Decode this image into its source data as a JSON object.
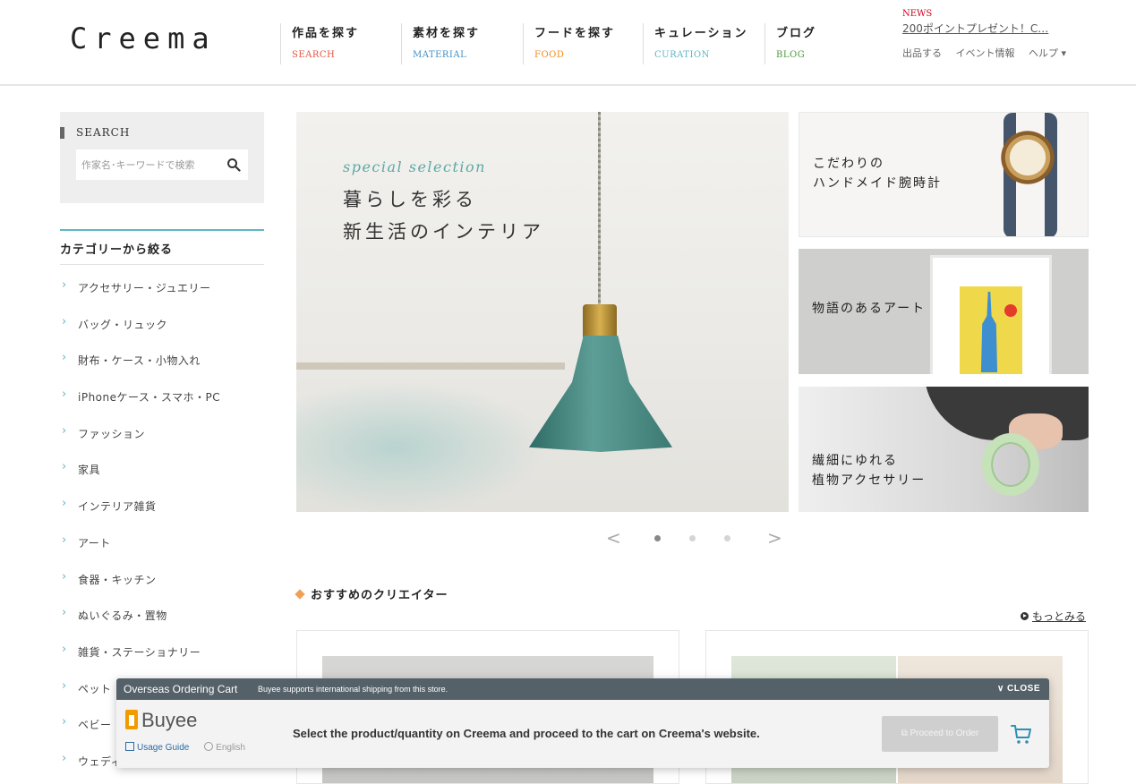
{
  "header": {
    "logo": "Creema",
    "nav": [
      {
        "jp": "作品を探す",
        "en": "SEARCH",
        "color": "#e5533d"
      },
      {
        "jp": "素材を探す",
        "en": "MATERIAL",
        "color": "#3f8fc5"
      },
      {
        "jp": "フードを探す",
        "en": "FOOD",
        "color": "#f08a1a"
      },
      {
        "jp": "キュレーション",
        "en": "CURATION",
        "color": "#5fb7c4"
      },
      {
        "jp": "ブログ",
        "en": "BLOG",
        "color": "#4a9a3a"
      }
    ],
    "news_label": "NEWS",
    "news_text": "200ポイントプレゼント！C…",
    "util_links": [
      "出品する",
      "イベント情報",
      "ヘルプ ▾"
    ]
  },
  "sidebar": {
    "search_title": "SEARCH",
    "search_placeholder": "作家名･キーワードで検索",
    "category_title": "カテゴリーから絞る",
    "categories": [
      "アクセサリー・ジュエリー",
      "バッグ・リュック",
      "財布・ケース・小物入れ",
      "iPhoneケース・スマホ・PC",
      "ファッション",
      "家具",
      "インテリア雑貨",
      "アート",
      "食器・キッチン",
      "ぬいぐるみ・置物",
      "雑貨・ステーショナリー",
      "ペット",
      "ベビー",
      "ウェディ"
    ]
  },
  "hero": {
    "subtitle": "special selection",
    "title_line1": "暮らしを彩る",
    "title_line2": "新生活のインテリア"
  },
  "banners": [
    {
      "text": "こだわりの\nハンドメイド腕時計"
    },
    {
      "text": "物語のあるアート"
    },
    {
      "text": "繊細にゆれる\n植物アクセサリー"
    }
  ],
  "carousel": {
    "prev": "<",
    "next": ">",
    "dot_count": 3,
    "active_index": 0
  },
  "recommended": {
    "title": "おすすめのクリエイター",
    "more": "もっとみる"
  },
  "buyee": {
    "bar_title": "Overseas Ordering Cart",
    "bar_subtitle": "Buyee supports international shipping from this store.",
    "close": "∨  CLOSE",
    "logo": "Buyee",
    "usage_guide": "Usage Guide",
    "language": "English",
    "message": "Select the product/quantity on Creema and proceed to the cart on Creema's website.",
    "proceed": "Proceed to Order"
  },
  "colors": {
    "accent_teal": "#5fb7c4",
    "buyee_orange": "#f29b00",
    "buyee_bar": "#546169"
  }
}
